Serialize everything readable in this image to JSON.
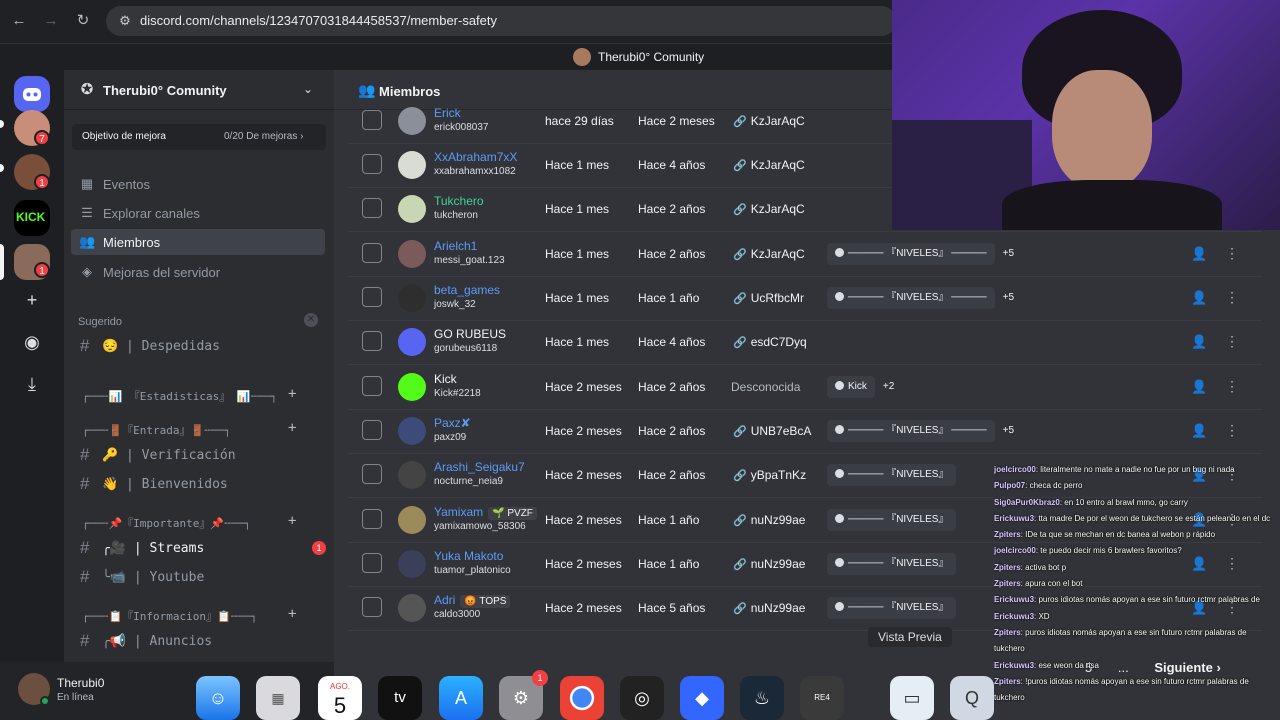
{
  "browser": {
    "url": "discord.com/channels/1234707031844458537/member-safety",
    "back_icon": "arrow-left-icon",
    "forward_icon": "arrow-right-icon",
    "reload_icon": "reload-icon"
  },
  "window_title": "Therubi0° Comunity",
  "server": {
    "name": "Therubi0° Comunity",
    "boost_goal": "Objetivo de mejora",
    "boost_progress": "0/20 De mejoras"
  },
  "rail": {
    "badges": [
      "7",
      "1",
      "1"
    ]
  },
  "sidebar": {
    "nav": [
      {
        "label": "Eventos",
        "icon": "calendar-icon"
      },
      {
        "label": "Explorar canales",
        "icon": "browse-channels-icon"
      },
      {
        "label": "Miembros",
        "icon": "members-icon"
      },
      {
        "label": "Mejoras del servidor",
        "icon": "boost-icon"
      }
    ],
    "suggested_title": "Sugerido",
    "channels": {
      "despedidas": "😔 | Despedidas",
      "cat_estadisticas": "┌──╌📊 『Estadisticas』 📊╌──┐",
      "cat_entrada": "┌──╌🚪『Entrada』🚪╌──┐",
      "verificacion": "🔑 | Verificación",
      "bienvenidos": "👋 | Bienvenidos",
      "cat_importante": "┌──╌📌『Importante』📌╌──┐",
      "streams": "╭🎥 | Streams",
      "streams_mentions": "1",
      "youtube": "╰📹 | Youtube",
      "cat_informacion": "┌──╌📋『Informacion』📋╌──┐",
      "anuncios": "╭📢 | Anuncios"
    }
  },
  "user": {
    "name": "Therubi0",
    "status": "En línea"
  },
  "main": {
    "title": "Miembros",
    "rows": [
      {
        "display": "Erick",
        "username": "erick008037",
        "color": "#5c9bf5",
        "joined": "hace 29 días",
        "account_age": "Hace 2 meses",
        "invite": "KzJarAqC",
        "role": "",
        "more": "",
        "avatar": "#8a8f99",
        "tag": ""
      },
      {
        "display": "XxAbraham7xX",
        "username": "xxabrahamxx1082",
        "color": "#5c9bf5",
        "joined": "Hace 1 mes",
        "account_age": "Hace 4 años",
        "invite": "KzJarAqC",
        "role": "",
        "more": "",
        "avatar": "#d9dcd2",
        "tag": ""
      },
      {
        "display": "Tukchero",
        "username": "tukcheron",
        "color": "#43d19a",
        "joined": "Hace 1 mes",
        "account_age": "Hace 2 años",
        "invite": "KzJarAqC",
        "role": "",
        "more": "",
        "avatar": "#c8d6b4",
        "tag": ""
      },
      {
        "display": "Arielch1",
        "username": "messi_goat.123",
        "color": "#5c9bf5",
        "joined": "Hace 1 mes",
        "account_age": "Hace 2 años",
        "invite": "KzJarAqC",
        "role": "───── 『NIVELES』 ─────",
        "more": "+5",
        "avatar": "#7a5a5a",
        "tag": ""
      },
      {
        "display": "beta_games",
        "username": "joswk_32",
        "color": "#5c9bf5",
        "joined": "Hace 1 mes",
        "account_age": "Hace 1 año",
        "invite": "UcRfbcMr",
        "role": "───── 『NIVELES』 ─────",
        "more": "+5",
        "avatar": "#2e2e2e",
        "tag": ""
      },
      {
        "display": "GO RUBEUS",
        "username": "gorubeus6118",
        "color": "#f2f3f5",
        "joined": "Hace 1 mes",
        "account_age": "Hace 4 años",
        "invite": "esdC7Dyq",
        "role": "",
        "more": "",
        "avatar": "#5865f2",
        "tag": ""
      },
      {
        "display": "Kick",
        "username": "Kick#2218",
        "color": "#f2f3f5",
        "joined": "Hace 2 meses",
        "account_age": "Hace 2 años",
        "invite": "Desconocida",
        "role": "Kick",
        "more": "+2",
        "avatar": "#53fc18",
        "tag": ""
      },
      {
        "display": "Paxz✘",
        "username": "paxz09",
        "color": "#5c9bf5",
        "joined": "Hace 2 meses",
        "account_age": "Hace 2 años",
        "invite": "UNB7eBcA",
        "role": "───── 『NIVELES』 ─────",
        "more": "+5",
        "avatar": "#3d4a7a",
        "tag": ""
      },
      {
        "display": "Arashi_Seigaku7",
        "username": "nocturne_neia9",
        "color": "#5c9bf5",
        "joined": "Hace 2 meses",
        "account_age": "Hace 2 años",
        "invite": "yBpaTnKz",
        "role": "───── 『NIVELES』",
        "more": "",
        "avatar": "#444",
        "tag": ""
      },
      {
        "display": "Yamixam",
        "username": "yamixamowo_58306",
        "color": "#5c9bf5",
        "joined": "Hace 2 meses",
        "account_age": "Hace 1 año",
        "invite": "nuNz99ae",
        "role": "───── 『NIVELES』",
        "more": "",
        "avatar": "#9c8a5a",
        "tag": "🌱 PVZF"
      },
      {
        "display": "Yuka Makoto",
        "username": "tuamor_platonico",
        "color": "#5c9bf5",
        "joined": "Hace 2 meses",
        "account_age": "Hace 1 año",
        "invite": "nuNz99ae",
        "role": "───── 『NIVELES』",
        "more": "",
        "avatar": "#3a3f5a",
        "tag": ""
      },
      {
        "display": "Adri",
        "username": "caldo3000",
        "color": "#5c9bf5",
        "joined": "Hace 2 meses",
        "account_age": "Hace 5 años",
        "invite": "nuNz99ae",
        "role": "───── 『NIVELES』",
        "more": "",
        "avatar": "#555",
        "tag": "😡 TOPS"
      }
    ],
    "tooltip": "Vista Previa",
    "pager_page": "5",
    "pager_ellipsis": "...",
    "pager_next": "Siguiente"
  },
  "chat": [
    {
      "user": "joelcirco00",
      "text": ": literalmente no mate a nadie no fue por un bug ni nada"
    },
    {
      "user": "Pulpo07",
      "text": ": checa dc perro"
    },
    {
      "user": "Sig0aPur0Kbraz0",
      "text": ": en 10 entro al brawl mmo, go carry"
    },
    {
      "user": "Erickuwu3",
      "text": ": tta madre De por el weon de tukchero se están peleando en el dc"
    },
    {
      "user": "Zpiters",
      "text": ": IDe ta que se mechan en dc banea al webon p rápido"
    },
    {
      "user": "joelcirco00",
      "text": ": te puedo decir mis 6 brawlers favoritos?"
    },
    {
      "user": "Zpiters",
      "text": ": activa bot p"
    },
    {
      "user": "Zpiters",
      "text": ": apura con el bot"
    },
    {
      "user": "Erickuwu3",
      "text": ": puros idiotas nomás apoyan a ese sin futuro rctmr palabras de"
    },
    {
      "user": "Erickuwu3",
      "text": ": XD"
    },
    {
      "user": "Zpiters",
      "text": ": puros idiotas nomás apoyan a ese sin futuro rctmr palabras de"
    },
    {
      "user": "",
      "text": "tukchero"
    },
    {
      "user": "Erickuwu3",
      "text": ": ese weon da risa"
    },
    {
      "user": "Zpiters",
      "text": ": !puros idiotas nomás apoyan a ese sin futuro rctmr palabras de"
    },
    {
      "user": "",
      "text": "tukchero"
    }
  ],
  "dock": {
    "calendar_month": "AGO.",
    "calendar_day": "5",
    "appstore_badge": "1",
    "tv_label": "tv"
  },
  "colors": {
    "accent": "#5865f2",
    "danger": "#f23f43",
    "online": "#23a55a"
  }
}
